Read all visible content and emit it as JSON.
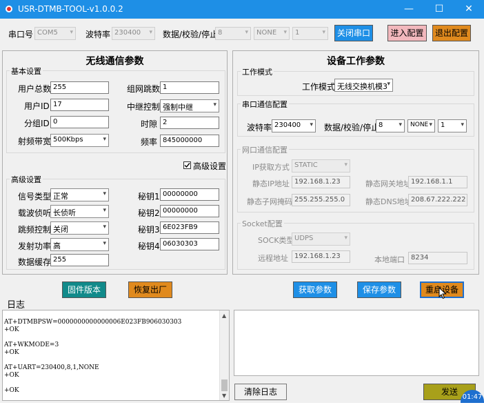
{
  "window": {
    "title": "USR-DTMB-TOOL-v1.0.0.2",
    "minimize": "—",
    "maximize": "☐",
    "close": "✕"
  },
  "toolbar": {
    "port_label": "串口号",
    "port_value": "COM5",
    "baud_label": "波特率",
    "baud_value": "230400",
    "data_label": "数据/校验/停止",
    "data_bits": "8",
    "parity": "NONE",
    "stop_bits": "1",
    "close_port": "关闭串口",
    "enter_config": "进入配置",
    "exit_config": "退出配置"
  },
  "wireless": {
    "title": "无线通信参数",
    "basic": {
      "group_label": "基本设置",
      "users_total_label": "用户总数",
      "users_total": "255",
      "group_hops_label": "组网跳数",
      "group_hops": "1",
      "user_id_label": "用户ID",
      "user_id": "17",
      "relay_label": "中继控制",
      "relay_value": "强制中继",
      "group_id_label": "分组ID",
      "group_id": "0",
      "slot_label": "时隙",
      "slot": "2",
      "bandwidth_label": "射频带宽",
      "bandwidth_value": "500Kbps",
      "freq_label": "频率",
      "freq": "845000000"
    },
    "advanced_checkbox_label": "高级设置",
    "advanced_checked": true,
    "advanced": {
      "group_label": "高级设置",
      "signal_type_label": "信号类型",
      "signal_type": "正常",
      "carrier_label": "载波侦听",
      "carrier": "长侦听",
      "hopping_label": "跳频控制",
      "hopping": "关闭",
      "power_label": "发射功率",
      "power": "高",
      "buffer_label": "数据缓存",
      "buffer": "255",
      "key1_label": "秘钥1",
      "key1": "00000000",
      "key2_label": "秘钥2",
      "key2": "00000000",
      "key3_label": "秘钥3",
      "key3": "6E023FB9",
      "key4_label": "秘钥4",
      "key4": "06030303"
    },
    "firmware_button": "固件版本",
    "reset_button": "恢复出厂"
  },
  "device": {
    "title": "设备工作参数",
    "mode_group": "工作模式",
    "mode_label": "工作模式",
    "mode_value": "无线交换机模3",
    "serial_group": "串口通信配置",
    "baud_label": "波特率",
    "baud_value": "230400",
    "data_label": "数据/校验/停止",
    "data_bits": "8",
    "parity": "NONE",
    "stop_bits": "1",
    "net_group": "网口通信配置",
    "ip_mode_label": "IP获取方式",
    "ip_mode": "STATIC",
    "static_ip_label": "静态IP地址",
    "static_ip": "192.168.1.23",
    "gateway_label": "静态网关地址",
    "gateway": "192.168.1.1",
    "mask_label": "静态子网掩码",
    "mask": "255.255.255.0",
    "dns_label": "静态DNS地址",
    "dns": "208.67.222.222",
    "socket_group": "Socket配置",
    "sock_type_label": "SOCK类型",
    "sock_type": "UDPS",
    "remote_label": "远程地址",
    "remote": "192.168.1.23",
    "local_port_label": "本地端口",
    "local_port": "8234",
    "get_button": "获取参数",
    "save_button": "保存参数",
    "restart_button": "重启设备"
  },
  "log": {
    "title": "日志",
    "lines": [
      "AT+DTMBPSW=0000000000000006E023FB906030303",
      "+OK",
      "",
      "AT+WKMODE=3",
      "+OK",
      "",
      "AT+UART=230400,8,1,NONE",
      "+OK",
      "",
      "+OK"
    ],
    "clear_button": "清除日志",
    "send_button": "发送"
  },
  "clock": {
    "time": "01:47"
  },
  "colors": {
    "titlebar": "#1e8fe6",
    "blue_button": "#1e8fe6",
    "teal_button": "#118a8a",
    "orange_button": "#e08a1e",
    "pink_button": "#f2b8bd",
    "olive_button": "#a8a01a"
  }
}
